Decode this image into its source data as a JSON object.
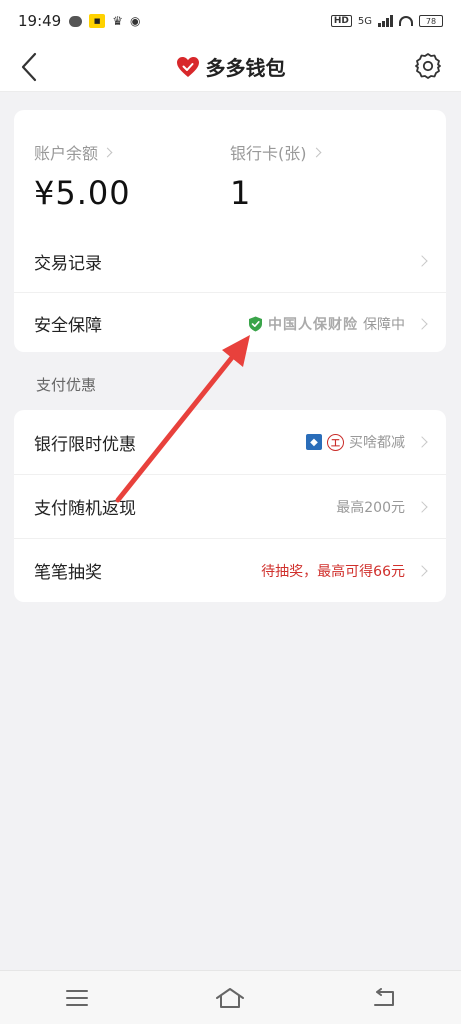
{
  "status_bar": {
    "time": "19:49",
    "network_label": "5G",
    "hd_label": "HD",
    "battery_label": "78"
  },
  "header": {
    "title": "多多钱包",
    "icons": [
      "back-arrow-icon",
      "heart-logo-icon",
      "gear-icon"
    ]
  },
  "balance": {
    "account_label": "账户余额",
    "account_value": "¥5.00",
    "card_label": "银行卡(张)",
    "card_value": "1"
  },
  "menu_top": [
    {
      "label": "交易记录",
      "right": ""
    },
    {
      "label": "安全保障",
      "right_brand": "中国人保财险",
      "right": "保障中"
    }
  ],
  "section": {
    "title": "支付优惠"
  },
  "menu_bottom": [
    {
      "label": "银行限时优惠",
      "right": "买啥都减"
    },
    {
      "label": "支付随机返现",
      "right": "最高200元"
    },
    {
      "label": "笔笔抽奖",
      "right": "待抽奖，最高可得66元"
    }
  ],
  "colors": {
    "accent_red": "#d0302c",
    "arrow_red": "#e8413c",
    "background": "#f2f2f4"
  }
}
